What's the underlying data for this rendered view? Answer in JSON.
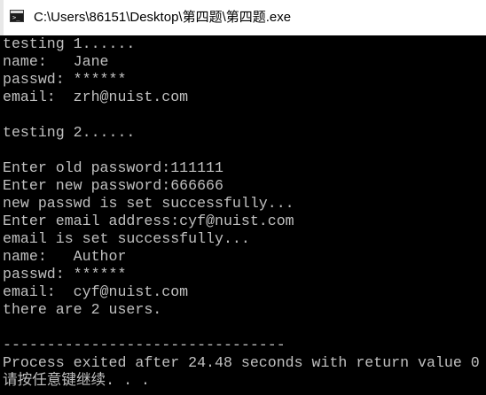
{
  "window": {
    "title": "C:\\Users\\86151\\Desktop\\第四题\\第四题.exe",
    "icon": "console-icon",
    "icon_glyph": ">_"
  },
  "colors": {
    "console_background": "#000000",
    "console_text": "#c0c0c0",
    "titlebar_background": "#ffffff"
  },
  "console": {
    "lines": [
      "testing 1......",
      "name:   Jane",
      "passwd: ******",
      "email:  zrh@nuist.com",
      "",
      "testing 2......",
      "",
      "Enter old password:111111",
      "Enter new password:666666",
      "new passwd is set successfully...",
      "Enter email address:cyf@nuist.com",
      "email is set successfully...",
      "name:   Author",
      "passwd: ******",
      "email:  cyf@nuist.com",
      "there are 2 users.",
      "",
      "--------------------------------",
      "Process exited after 24.48 seconds with return value 0",
      "请按任意键继续. . ."
    ]
  }
}
